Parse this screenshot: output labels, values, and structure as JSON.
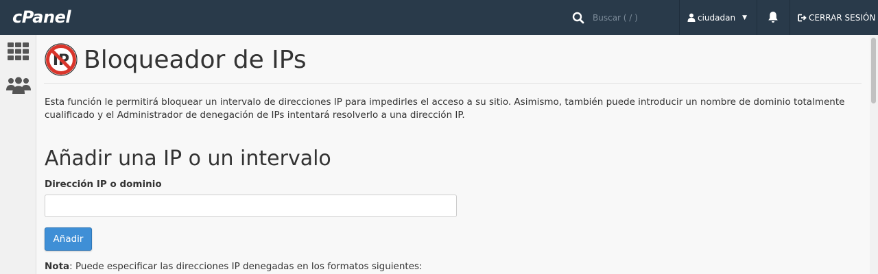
{
  "header": {
    "logo_text": "cPanel",
    "search_placeholder": "Buscar ( / )",
    "username": "ciudadan",
    "logout_label": "CERRAR SESIÓN"
  },
  "sidebar": {
    "items": [
      {
        "icon": "grid-icon"
      },
      {
        "icon": "users-icon"
      }
    ]
  },
  "page": {
    "title": "Bloqueador de IPs",
    "description": "Esta función le permitirá bloquear un intervalo de direcciones IP para impedirles el acceso a su sitio. Asimismo, también puede introducir un nombre de dominio totalmente cualificado y el Administrador de denegación de IPs intentará resolverlo a una dirección IP.",
    "section_title": "Añadir una IP o un intervalo",
    "field_label": "Dirección IP o dominio",
    "field_value": "",
    "add_button": "Añadir",
    "note_label": "Nota",
    "note_text": ": Puede especificar las direcciones IP denegadas en los formatos siguientes:"
  },
  "colors": {
    "topbar": "#293a4a",
    "accent": "#3f8fd6",
    "block_icon_red": "#d9352b"
  }
}
